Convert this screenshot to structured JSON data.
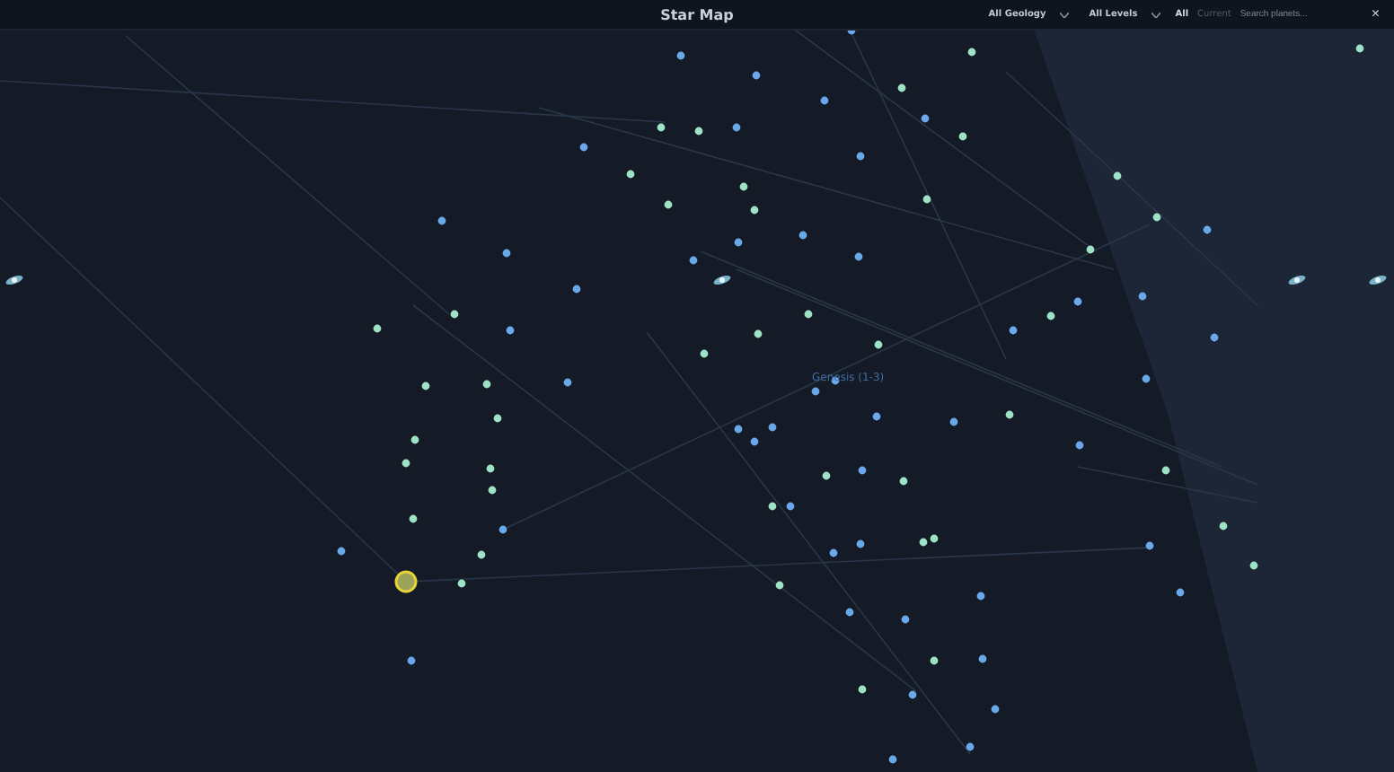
{
  "window": {
    "title": "Star Map"
  },
  "filters": [
    {
      "label": "All Geology"
    },
    {
      "label": "All Levels"
    }
  ],
  "scope_toggle": [
    {
      "label": "All",
      "selected": true
    },
    {
      "label": "Current",
      "selected": false
    }
  ],
  "search": {
    "placeholder": "Search planets..."
  },
  "close_button": {
    "label": "×"
  },
  "cluster_label": {
    "label": "Genesis (1-3)"
  }
}
